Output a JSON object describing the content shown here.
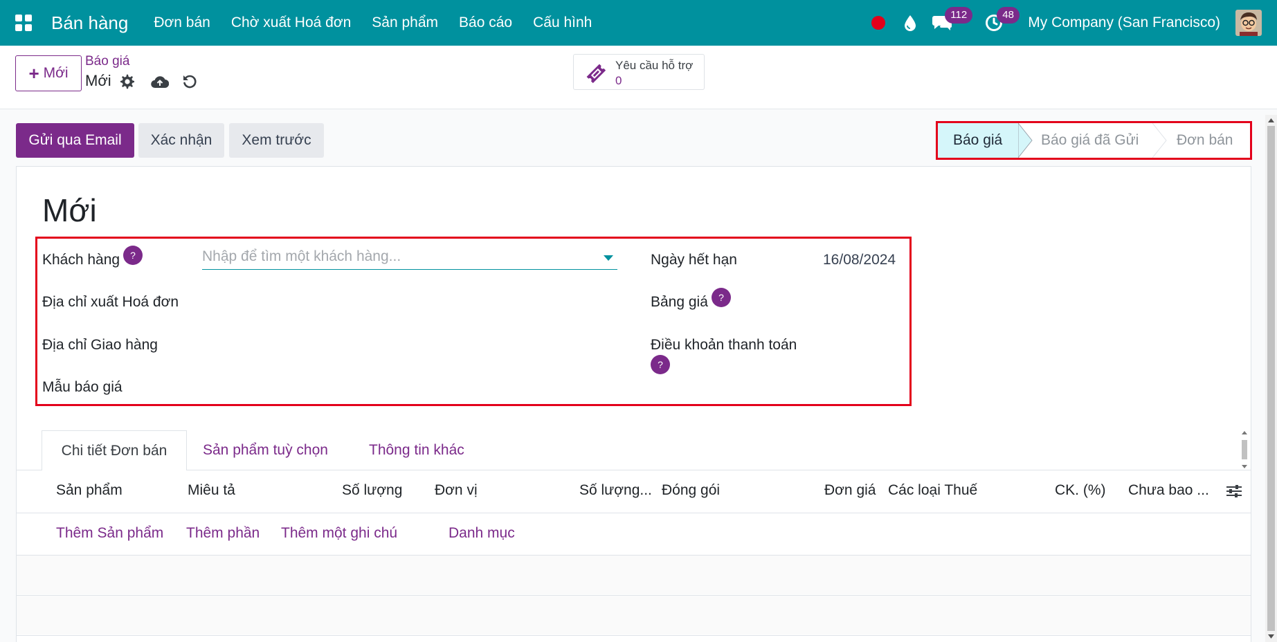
{
  "navbar": {
    "app_name": "Bán hàng",
    "menu": [
      "Đơn bán",
      "Chờ xuất Hoá đơn",
      "Sản phẩm",
      "Báo cáo",
      "Cấu hình"
    ],
    "messages_count": "112",
    "activities_count": "48",
    "company": "My Company (San Francisco)"
  },
  "control_panel": {
    "new_label": "Mới",
    "breadcrumb": "Báo giá",
    "record_name": "Mới",
    "support_title": "Yêu cầu hỗ trợ",
    "support_count": "0"
  },
  "actions": {
    "send_email": "Gửi qua Email",
    "confirm": "Xác nhận",
    "preview": "Xem trước"
  },
  "status": {
    "steps": [
      "Báo giá",
      "Báo giá đã Gửi",
      "Đơn bán"
    ],
    "active": "Báo giá"
  },
  "form": {
    "title": "Mới",
    "customer_label": "Khách hàng",
    "customer_placeholder": "Nhập để tìm một khách hàng...",
    "invoice_address_label": "Địa chỉ xuất Hoá đơn",
    "delivery_address_label": "Địa chỉ Giao hàng",
    "quote_template_label": "Mẫu báo giá",
    "expiration_label": "Ngày hết hạn",
    "expiration_value": "16/08/2024",
    "pricelist_label": "Bảng giá",
    "payment_terms_label": "Điều khoản thanh toán",
    "help_mark": "?"
  },
  "tabs": [
    "Chi tiết Đơn bán",
    "Sản phẩm tuỳ chọn",
    "Thông tin khác"
  ],
  "table": {
    "columns": [
      "Sản phẩm",
      "Miêu tả",
      "Số lượng",
      "Đơn vị",
      "Số lượng...",
      "Đóng gói",
      "Đơn giá",
      "Các loại Thuế",
      "CK. (%)",
      "Chưa bao ..."
    ],
    "add_links": [
      "Thêm Sản phẩm",
      "Thêm phần",
      "Thêm một ghi chú",
      "Danh mục"
    ]
  },
  "colors": {
    "navbar": "#00919e",
    "primary": "#7b2a8a",
    "highlight_border": "#e3001b",
    "status_active_bg": "#d5f6fa"
  }
}
